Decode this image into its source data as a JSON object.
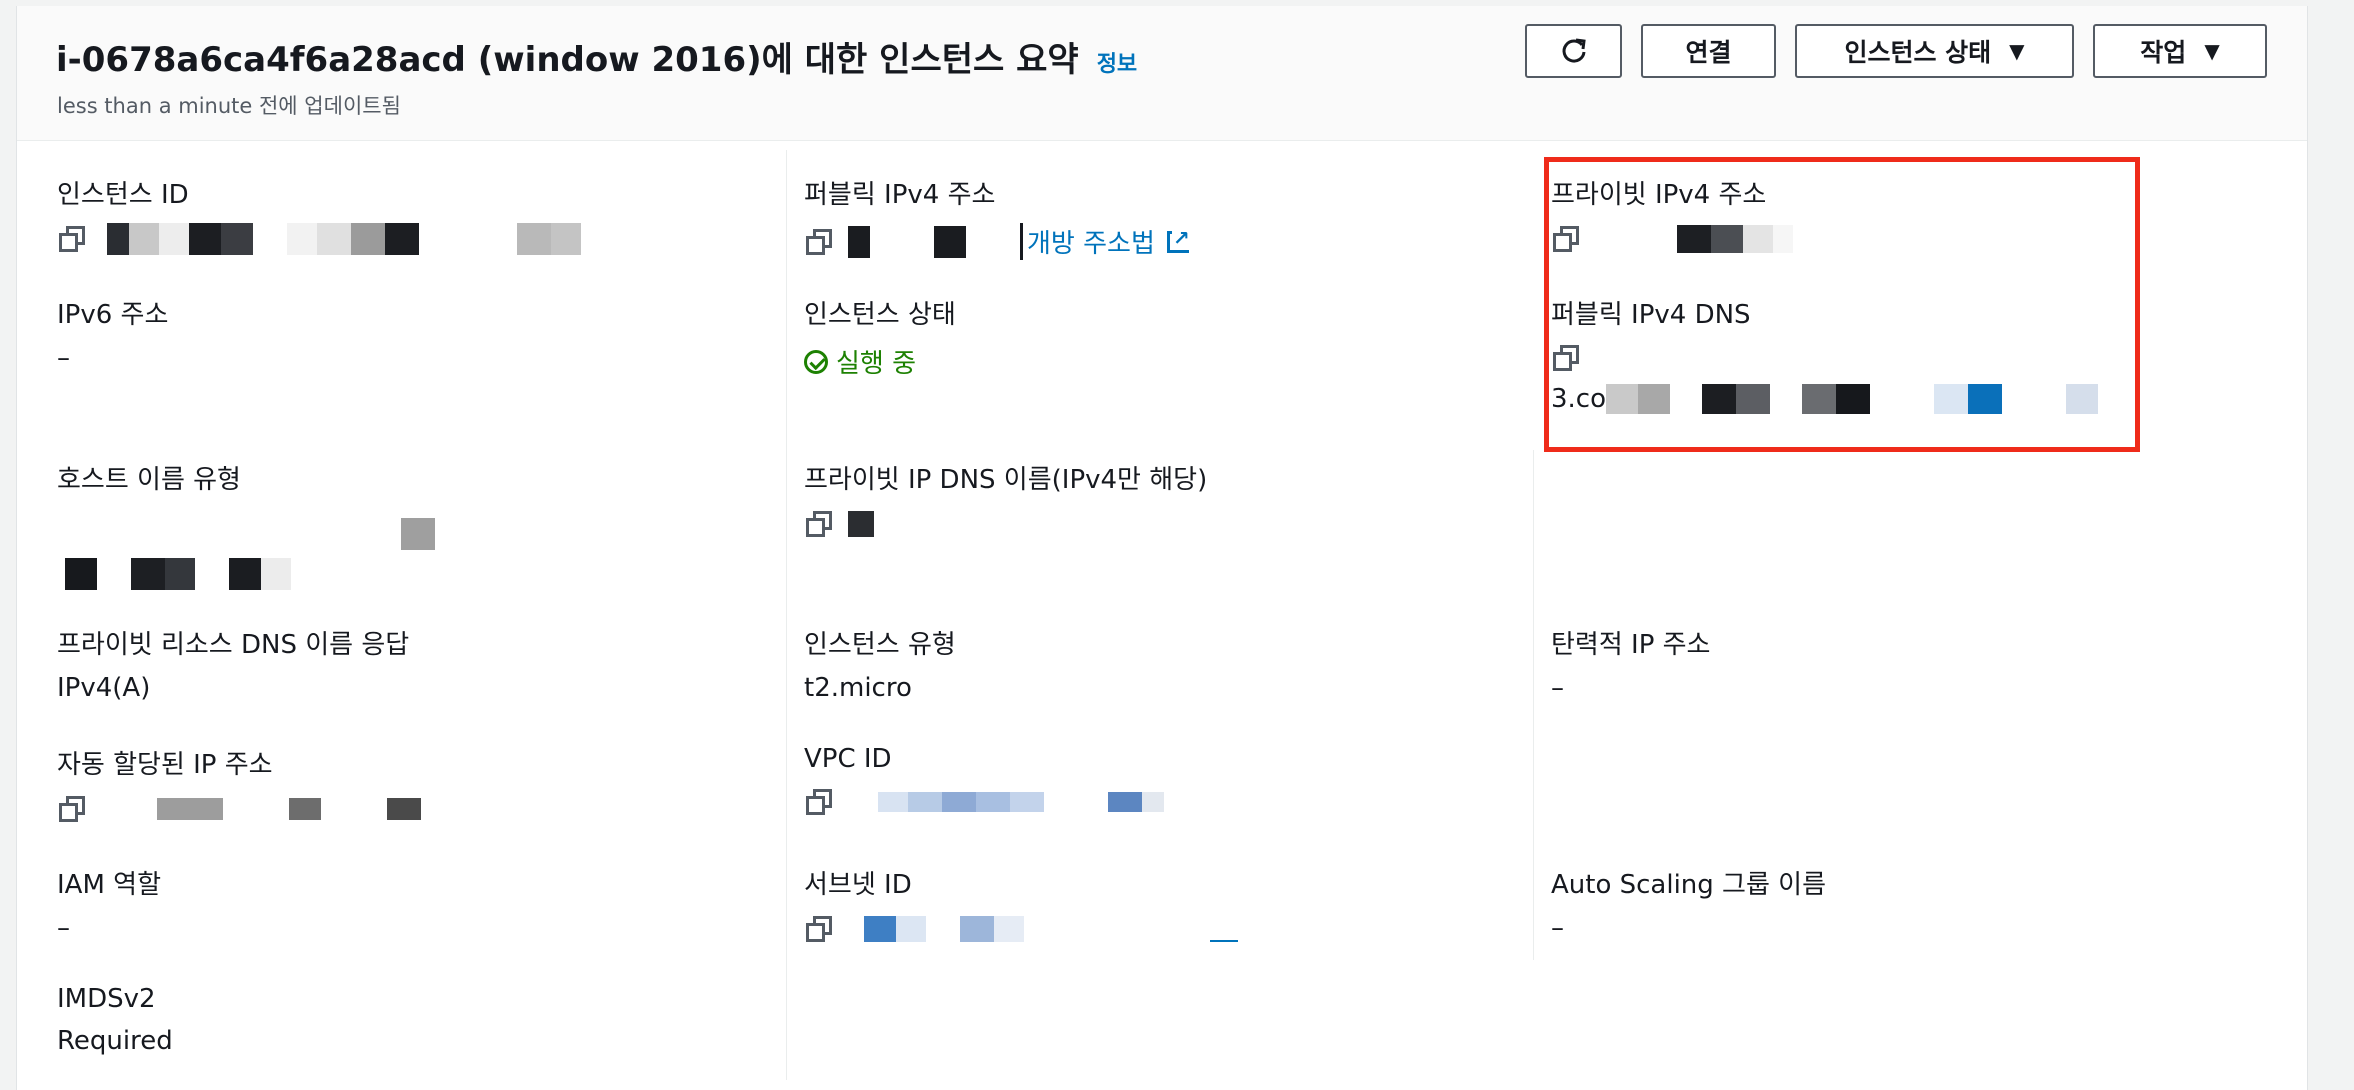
{
  "header": {
    "title": "i-0678a6ca4f6a28acd (window 2016)에 대한 인스턴스 요약",
    "info_link": "정보",
    "subtitle": "less than a minute 전에 업데이트됨"
  },
  "buttons": {
    "connect": "연결",
    "instance_state": "인스턴스 상태",
    "actions": "작업"
  },
  "fields": {
    "instance_id": {
      "label": "인스턴스 ID"
    },
    "public_ipv4": {
      "label": "퍼블릭 IPv4 주소",
      "link": "개방 주소법"
    },
    "private_ipv4": {
      "label": "프라이빗 IPv4 주소"
    },
    "ipv6": {
      "label": "IPv6 주소",
      "value": "–"
    },
    "instance_state": {
      "label": "인스턴스 상태",
      "value": "실행 중"
    },
    "public_dns": {
      "label": "퍼블릭 IPv4 DNS",
      "value_prefix": "3.co"
    },
    "hostname_type": {
      "label": "호스트 이름 유형"
    },
    "private_ip_dns": {
      "label": "프라이빗 IP DNS 이름(IPv4만 해당)"
    },
    "private_resource_dns": {
      "label": "프라이빗 리소스 DNS 이름 응답",
      "value": "IPv4(A)"
    },
    "instance_type": {
      "label": "인스턴스 유형",
      "value": "t2.micro"
    },
    "elastic_ip": {
      "label": "탄력적 IP 주소",
      "value": "–"
    },
    "auto_ip": {
      "label": "자동 할당된 IP 주소"
    },
    "vpc_id": {
      "label": "VPC ID"
    },
    "iam_role": {
      "label": "IAM 역할",
      "value": "–"
    },
    "subnet_id": {
      "label": "서브넷 ID"
    },
    "auto_scaling": {
      "label": "Auto Scaling 그룹 이름",
      "value": "–"
    },
    "imdsv2": {
      "label": "IMDSv2",
      "value": "Required"
    }
  },
  "icons": {
    "refresh": "refresh-icon",
    "copy": "copy-icon",
    "external": "external-link-icon",
    "status": "check-circle-icon",
    "caret": "caret-down-icon"
  },
  "colors": {
    "link": "#0073bb",
    "success": "#1d8102",
    "highlight": "#ef2b1a"
  }
}
